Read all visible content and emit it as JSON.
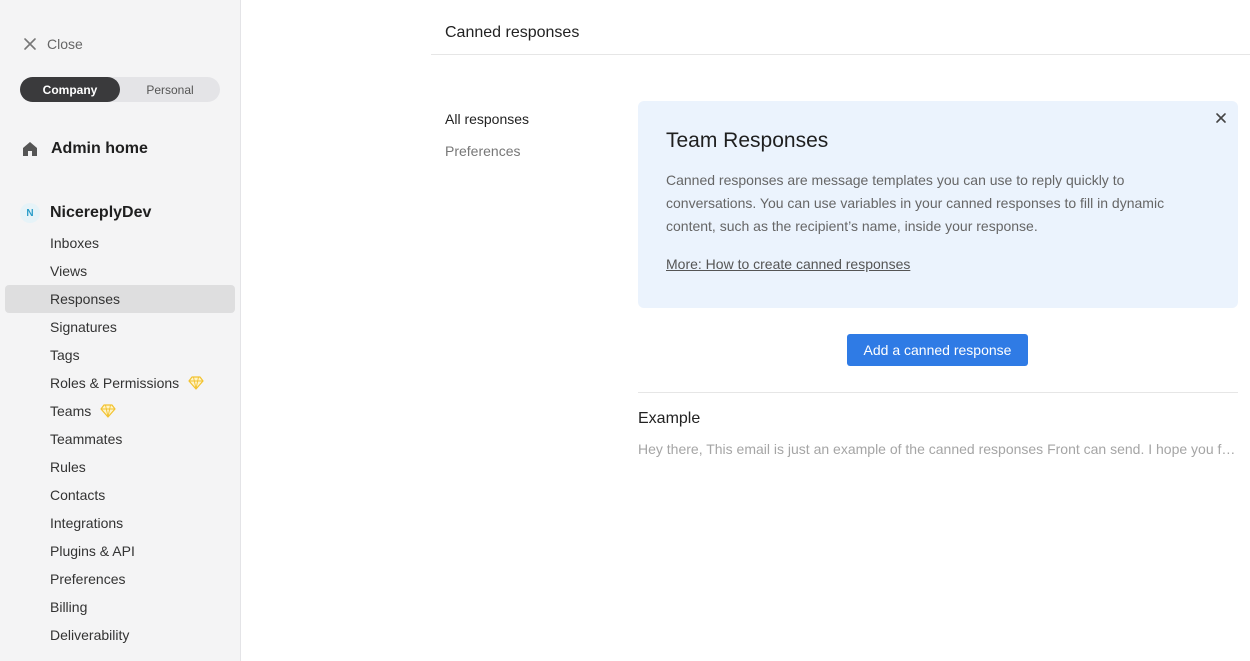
{
  "sidebar": {
    "close_label": "Close",
    "scope_tabs": [
      {
        "label": "Company",
        "active": true
      },
      {
        "label": "Personal",
        "active": false
      }
    ],
    "admin_home_label": "Admin home",
    "company": {
      "avatar_letter": "N",
      "name": "NicereplyDev"
    },
    "nav_items": [
      {
        "label": "Inboxes"
      },
      {
        "label": "Views"
      },
      {
        "label": "Responses",
        "active": true
      },
      {
        "label": "Signatures"
      },
      {
        "label": "Tags"
      },
      {
        "label": "Roles & Permissions",
        "premium_icon": "gem-icon"
      },
      {
        "label": "Teams",
        "premium_icon": "gem-icon"
      },
      {
        "label": "Teammates"
      },
      {
        "label": "Rules"
      },
      {
        "label": "Contacts"
      },
      {
        "label": "Integrations"
      },
      {
        "label": "Plugins & API"
      },
      {
        "label": "Preferences"
      },
      {
        "label": "Billing"
      },
      {
        "label": "Deliverability"
      }
    ]
  },
  "main": {
    "page_title": "Canned responses",
    "subnav": [
      {
        "label": "All responses",
        "active": true
      },
      {
        "label": "Preferences",
        "active": false
      }
    ],
    "info_card": {
      "title": "Team Responses",
      "description": "Canned responses are message templates you can use to reply quickly to conversations. You can use variables in your canned responses to fill in dynamic content, such as the recipient’s name, inside your response.",
      "link_text": "More: How to create canned responses"
    },
    "add_button_label": "Add a canned response",
    "example": {
      "title": "Example",
      "preview": "Hey there, This email is just an example of the canned responses Front can send. I hope you find it useful!"
    }
  },
  "colors": {
    "accent": "#2f7be5",
    "card_bg": "#ebf3fd",
    "sidebar_bg": "#f4f4f5",
    "premium_gem": "#f2c230"
  }
}
